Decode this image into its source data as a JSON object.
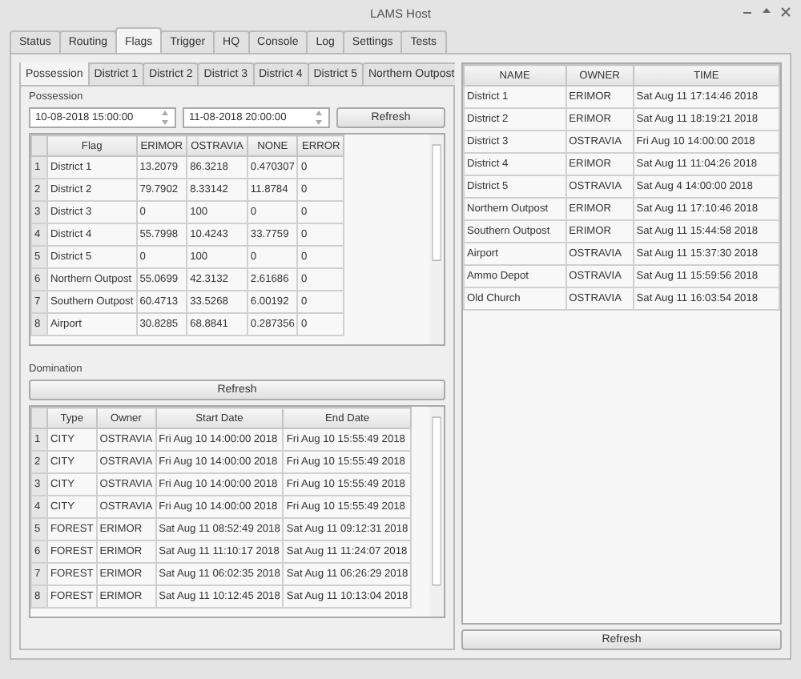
{
  "window": {
    "title": "LAMS Host"
  },
  "tabs": [
    {
      "label": "Status",
      "selected": false
    },
    {
      "label": "Routing",
      "selected": false
    },
    {
      "label": "Flags",
      "selected": true
    },
    {
      "label": "Trigger",
      "selected": false
    },
    {
      "label": "HQ",
      "selected": false
    },
    {
      "label": "Console",
      "selected": false
    },
    {
      "label": "Log",
      "selected": false
    },
    {
      "label": "Settings",
      "selected": false
    },
    {
      "label": "Tests",
      "selected": false
    }
  ],
  "subtabs": [
    {
      "label": "Possession",
      "selected": true
    },
    {
      "label": "District 1",
      "selected": false
    },
    {
      "label": "District 2",
      "selected": false
    },
    {
      "label": "District 3",
      "selected": false
    },
    {
      "label": "District 4",
      "selected": false
    },
    {
      "label": "District 5",
      "selected": false
    },
    {
      "label": "Northern Outpost",
      "selected": false
    }
  ],
  "possession": {
    "title": "Possession",
    "start": "10-08-2018 15:00:00",
    "end": "11-08-2018 20:00:00",
    "refresh": "Refresh",
    "columns": [
      "",
      "Flag",
      "ERIMOR",
      "OSTRAVIA",
      "NONE",
      "ERROR"
    ],
    "rows": [
      [
        "1",
        "District 1",
        "13.2079",
        "86.3218",
        "0.470307",
        "0"
      ],
      [
        "2",
        "District 2",
        "79.7902",
        "8.33142",
        "11.8784",
        "0"
      ],
      [
        "3",
        "District 3",
        "0",
        "100",
        "0",
        "0"
      ],
      [
        "4",
        "District 4",
        "55.7998",
        "10.4243",
        "33.7759",
        "0"
      ],
      [
        "5",
        "District 5",
        "0",
        "100",
        "0",
        "0"
      ],
      [
        "6",
        "Northern Outpost",
        "55.0699",
        "42.3132",
        "2.61686",
        "0"
      ],
      [
        "7",
        "Southern Outpost",
        "60.4713",
        "33.5268",
        "6.00192",
        "0"
      ],
      [
        "8",
        "Airport",
        "30.8285",
        "68.8841",
        "0.287356",
        "0"
      ]
    ]
  },
  "domination": {
    "title": "Domination",
    "refresh": "Refresh",
    "columns": [
      "",
      "Type",
      "Owner",
      "Start Date",
      "End Date"
    ],
    "rows": [
      [
        "1",
        "CITY",
        "OSTRAVIA",
        "Fri Aug 10 14:00:00 2018",
        "Fri Aug 10 15:55:49 2018"
      ],
      [
        "2",
        "CITY",
        "OSTRAVIA",
        "Fri Aug 10 14:00:00 2018",
        "Fri Aug 10 15:55:49 2018"
      ],
      [
        "3",
        "CITY",
        "OSTRAVIA",
        "Fri Aug 10 14:00:00 2018",
        "Fri Aug 10 15:55:49 2018"
      ],
      [
        "4",
        "CITY",
        "OSTRAVIA",
        "Fri Aug 10 14:00:00 2018",
        "Fri Aug 10 15:55:49 2018"
      ],
      [
        "5",
        "FOREST",
        "ERIMOR",
        "Sat Aug 11 08:52:49 2018",
        "Sat Aug 11 09:12:31 2018"
      ],
      [
        "6",
        "FOREST",
        "ERIMOR",
        "Sat Aug 11 11:10:17 2018",
        "Sat Aug 11 11:24:07 2018"
      ],
      [
        "7",
        "FOREST",
        "ERIMOR",
        "Sat Aug 11 06:02:35 2018",
        "Sat Aug 11 06:26:29 2018"
      ],
      [
        "8",
        "FOREST",
        "ERIMOR",
        "Sat Aug 11 10:12:45 2018",
        "Sat Aug 11 10:13:04 2018"
      ]
    ]
  },
  "flags": {
    "columns": [
      "NAME",
      "OWNER",
      "TIME"
    ],
    "refresh": "Refresh",
    "rows": [
      [
        "District 1",
        "ERIMOR",
        "Sat Aug 11 17:14:46 2018"
      ],
      [
        "District 2",
        "ERIMOR",
        "Sat Aug 11 18:19:21 2018"
      ],
      [
        "District 3",
        "OSTRAVIA",
        "Fri Aug 10 14:00:00 2018"
      ],
      [
        "District 4",
        "ERIMOR",
        "Sat Aug 11 11:04:26 2018"
      ],
      [
        "District 5",
        "OSTRAVIA",
        "Sat Aug 4 14:00:00 2018"
      ],
      [
        "Northern Outpost",
        "ERIMOR",
        "Sat Aug 11 17:10:46 2018"
      ],
      [
        "Southern Outpost",
        "ERIMOR",
        "Sat Aug 11 15:44:58 2018"
      ],
      [
        "Airport",
        "OSTRAVIA",
        "Sat Aug 11 15:37:30 2018"
      ],
      [
        "Ammo Depot",
        "OSTRAVIA",
        "Sat Aug 11 15:59:56 2018"
      ],
      [
        "Old Church",
        "OSTRAVIA",
        "Sat Aug 11 16:03:54 2018"
      ]
    ]
  }
}
